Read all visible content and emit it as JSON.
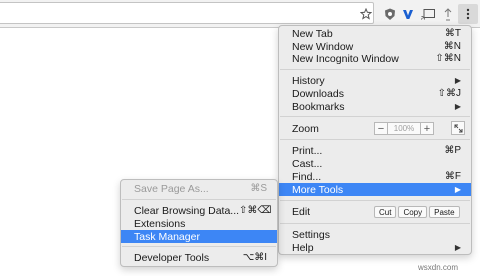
{
  "toolbar": {
    "icons": [
      "star-icon",
      "shield-extension-icon",
      "v-extension-icon",
      "cast-icon",
      "tack-extension-icon",
      "menu-icon"
    ]
  },
  "menu": {
    "new_tab": {
      "label": "New Tab",
      "shortcut": "⌘T"
    },
    "new_window": {
      "label": "New Window",
      "shortcut": "⌘N"
    },
    "new_incognito": {
      "label": "New Incognito Window",
      "shortcut": "⇧⌘N"
    },
    "history": {
      "label": "History"
    },
    "downloads": {
      "label": "Downloads",
      "shortcut": "⇧⌘J"
    },
    "bookmarks": {
      "label": "Bookmarks"
    },
    "zoom": {
      "label": "Zoom",
      "minus": "−",
      "value": "100%",
      "plus": "+"
    },
    "print": {
      "label": "Print...",
      "shortcut": "⌘P"
    },
    "cast": {
      "label": "Cast..."
    },
    "find": {
      "label": "Find...",
      "shortcut": "⌘F"
    },
    "more_tools": {
      "label": "More Tools"
    },
    "edit": {
      "label": "Edit",
      "cut": "Cut",
      "copy": "Copy",
      "paste": "Paste"
    },
    "settings": {
      "label": "Settings"
    },
    "help": {
      "label": "Help"
    }
  },
  "submenu": {
    "save_page": {
      "label": "Save Page As...",
      "shortcut": "⌘S"
    },
    "clear_browsing": {
      "label": "Clear Browsing Data...",
      "shortcut": "⇧⌘⌫"
    },
    "extensions": {
      "label": "Extensions"
    },
    "task_manager": {
      "label": "Task Manager"
    },
    "developer_tools": {
      "label": "Developer Tools",
      "shortcut": "⌥⌘I"
    }
  },
  "watermark": "wsxdn.com",
  "colors": {
    "highlight": "#3d86f5"
  }
}
